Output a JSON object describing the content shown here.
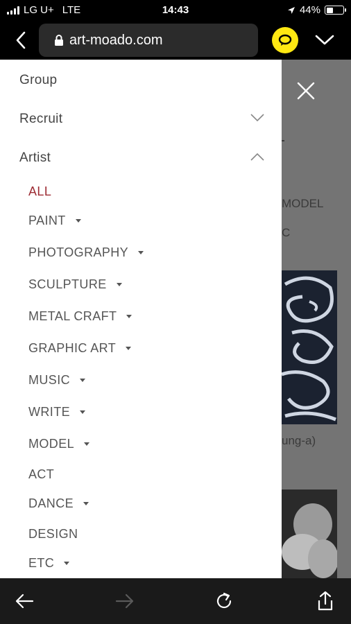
{
  "status_bar": {
    "carrier": "LG U+",
    "network": "LTE",
    "time": "14:43",
    "battery_percent": "44%",
    "battery_level": 0.44
  },
  "browser": {
    "url": "art-moado.com",
    "kakao_color": "#ffe812"
  },
  "background_page": {
    "text_model": "MODEL",
    "text_c": "C",
    "text_caption": "ung-a)"
  },
  "drawer": {
    "items": [
      {
        "label": "Group"
      },
      {
        "label": "Recruit",
        "expandable": true,
        "expanded": false
      },
      {
        "label": "Artist",
        "expandable": true,
        "expanded": true
      }
    ],
    "artist_submenu": [
      {
        "label": "ALL",
        "active": true,
        "has_caret": false
      },
      {
        "label": "PAINT",
        "has_caret": true
      },
      {
        "label": "PHOTOGRAPHY",
        "has_caret": true
      },
      {
        "label": "SCULPTURE",
        "has_caret": true
      },
      {
        "label": "METAL CRAFT",
        "has_caret": true
      },
      {
        "label": "GRAPHIC ART",
        "has_caret": true
      },
      {
        "label": "MUSIC",
        "has_caret": true
      },
      {
        "label": "WRITE",
        "has_caret": true
      },
      {
        "label": "MODEL",
        "has_caret": true
      },
      {
        "label": "ACT",
        "has_caret": false
      },
      {
        "label": "DANCE",
        "has_caret": true
      },
      {
        "label": "DESIGN",
        "has_caret": false
      },
      {
        "label": "ETC",
        "has_caret": true
      }
    ],
    "active_color": "#9d2c34"
  },
  "toolbar": {
    "icons": [
      "back-arrow-icon",
      "forward-arrow-icon",
      "reload-icon",
      "share-icon"
    ]
  }
}
